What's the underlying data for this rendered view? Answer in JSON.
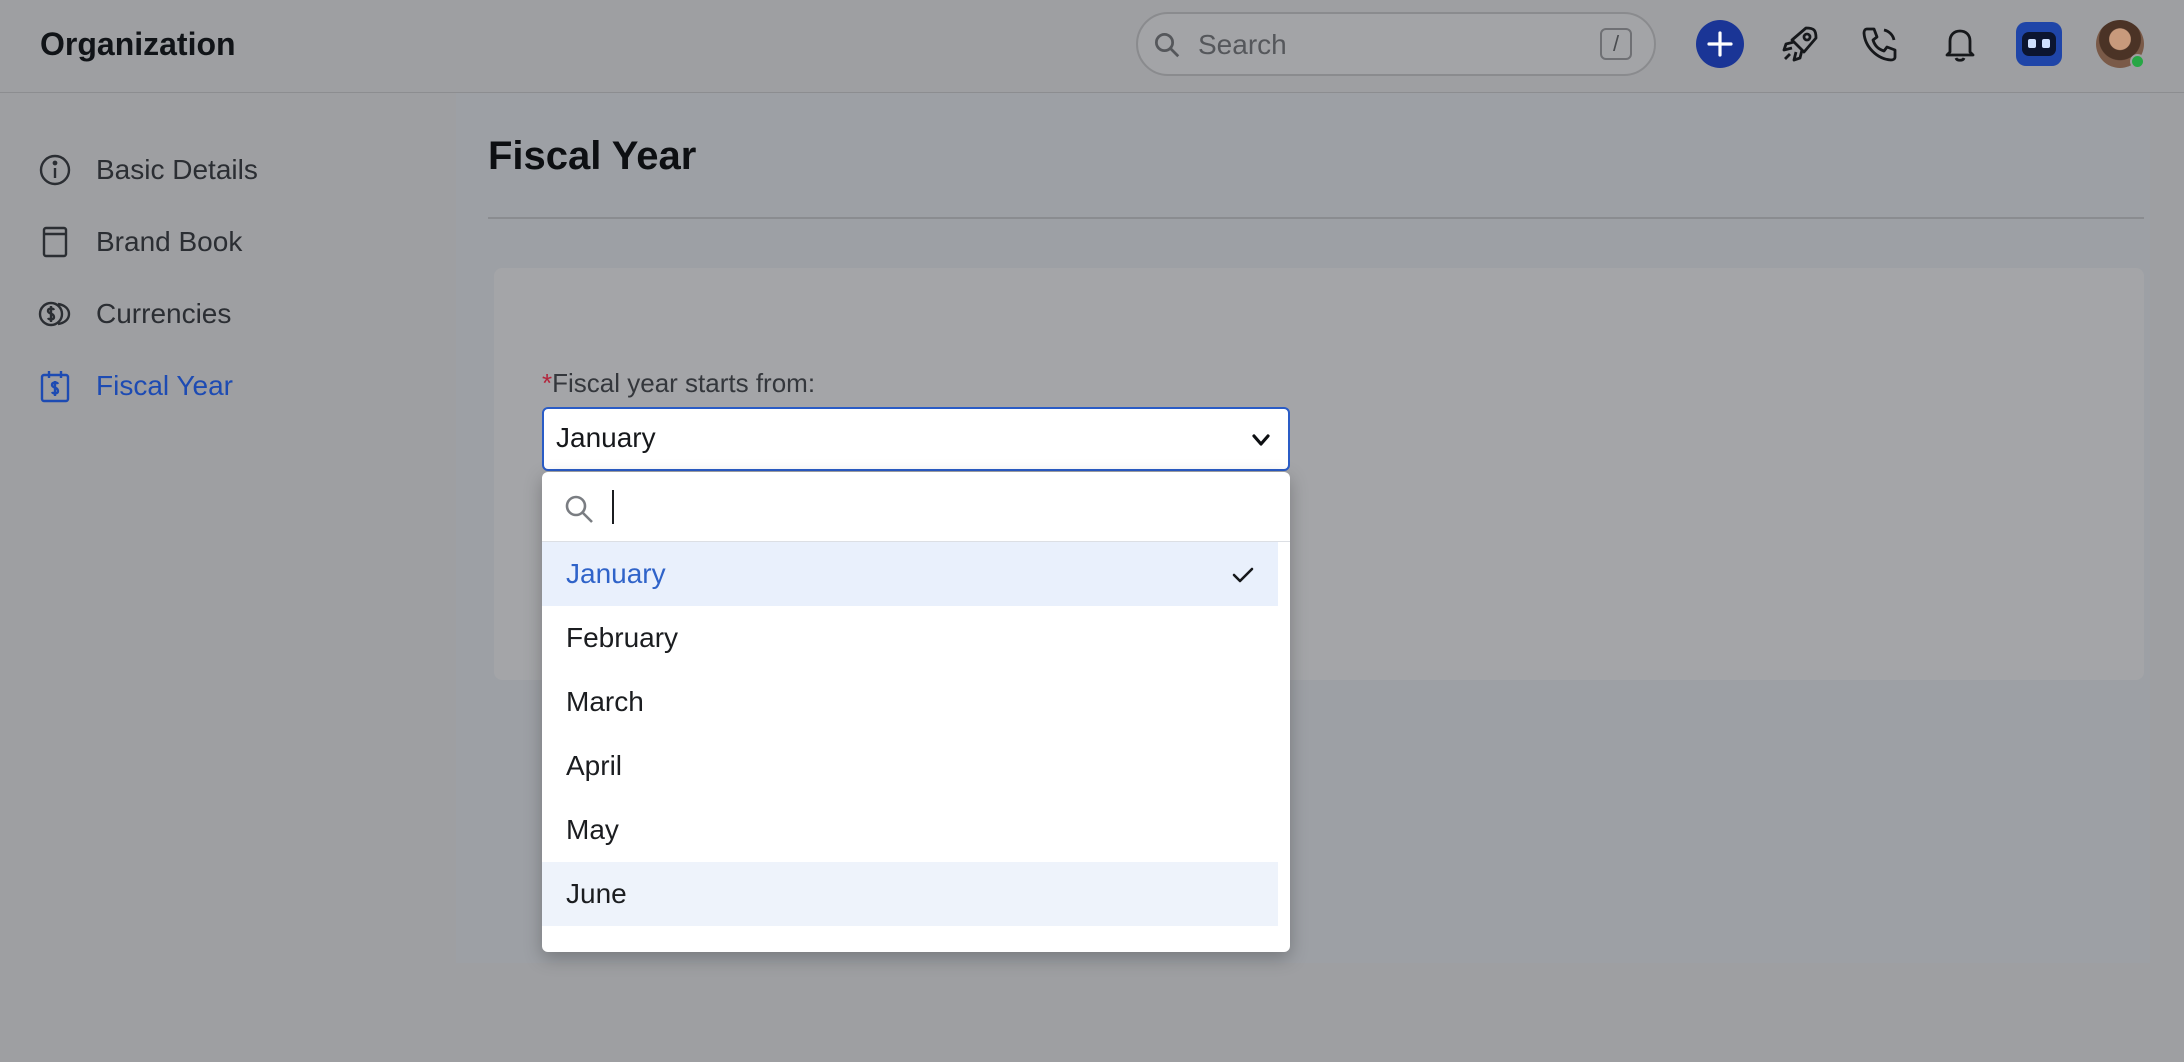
{
  "header": {
    "title": "Organization",
    "search": {
      "placeholder": "Search",
      "shortcut": "/"
    },
    "icons": [
      "plus-icon",
      "rocket-icon",
      "phone-icon",
      "bell-icon",
      "bot-icon",
      "avatar"
    ]
  },
  "sidebar": {
    "items": [
      {
        "label": "Basic Details",
        "icon": "info-icon",
        "active": false
      },
      {
        "label": "Brand Book",
        "icon": "book-icon",
        "active": false
      },
      {
        "label": "Currencies",
        "icon": "currency-icon",
        "active": false
      },
      {
        "label": "Fiscal Year",
        "icon": "calendar-dollar-icon",
        "active": true
      }
    ]
  },
  "main": {
    "title": "Fiscal Year",
    "field": {
      "required_mark": "*",
      "label": "Fiscal year starts from:",
      "selected_value": "January"
    },
    "dropdown": {
      "search_value": "",
      "options": [
        "January",
        "February",
        "March",
        "April",
        "May",
        "June"
      ],
      "selected": "January",
      "hovered": "June"
    }
  },
  "colors": {
    "accent": "#2a5cc6",
    "active_nav": "#1d4bb3",
    "required": "#b3263d",
    "plus_button": "#1a3596"
  }
}
